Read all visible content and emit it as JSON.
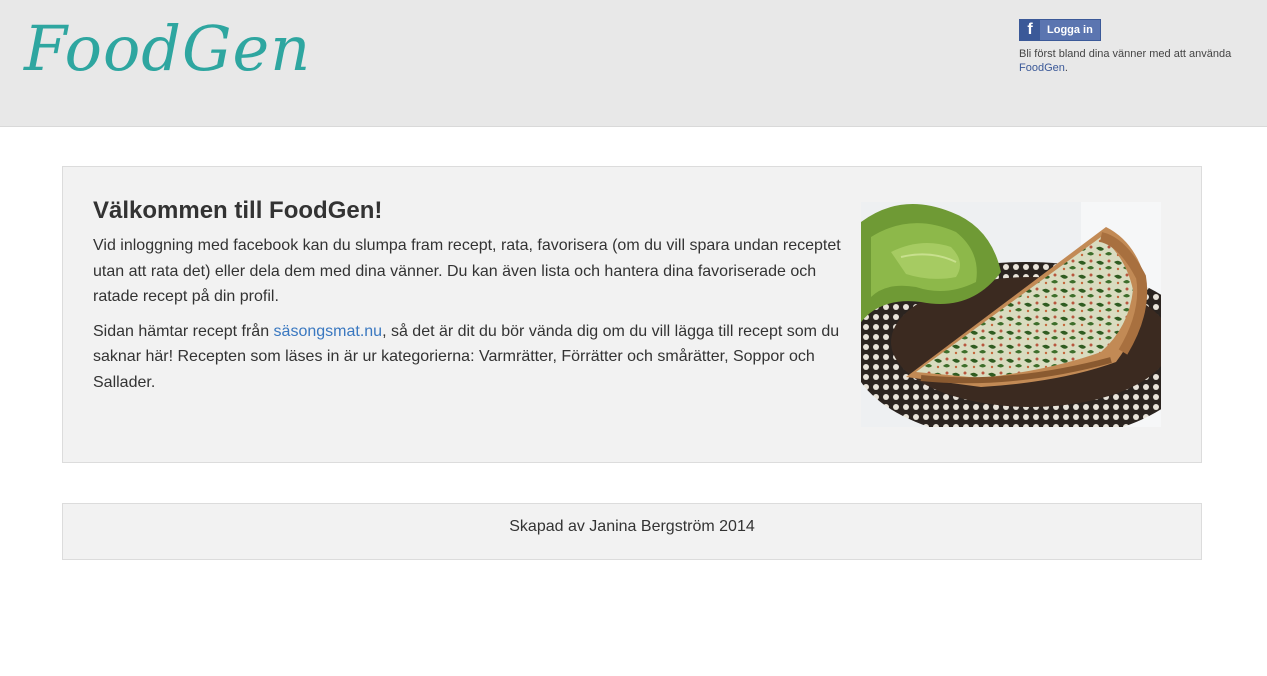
{
  "header": {
    "logo_text": "FoodGen",
    "facebook": {
      "login_label": "Logga in",
      "icon": "facebook-f-icon",
      "prompt_text": "Bli först bland dina vänner med att använda",
      "app_link": "FoodGen",
      "trailing": "."
    }
  },
  "main": {
    "title": "Välkommen till FoodGen!",
    "paragraph1": "Vid inloggning med facebook kan du slumpa fram recept, rata, favorisera (om du vill spara undan receptet utan att rata det) eller dela dem med dina vänner. Du kan även lista och hantera dina favoriserade och ratade recept på din profil.",
    "paragraph2_before": "Sidan hämtar recept från ",
    "paragraph2_link": "säsongsmat.nu",
    "paragraph2_after": ", så det är dit du bör vända dig om du vill lägga till recept som du saknar här! Recepten som läses in är ur kategorierna: Varmrätter, Förrätter och smårätter, Soppor och Sallader."
  },
  "footer": {
    "credit": "Skapad av Janina Bergström 2014"
  },
  "colors": {
    "logo": "#2ea6a0",
    "header_bg": "#e8e8e8",
    "panel_bg": "#f2f2f2",
    "facebook": "#3b5998",
    "link": "#3a78c0"
  }
}
